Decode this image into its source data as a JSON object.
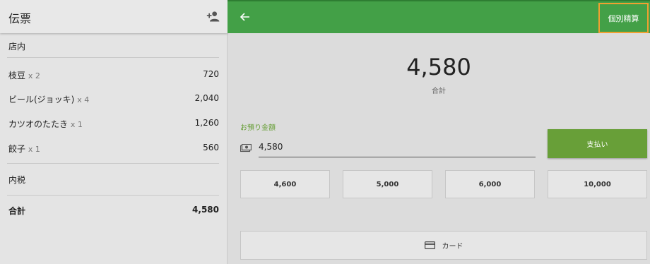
{
  "colors": {
    "topbar": "#43a047",
    "accent_green": "#689f38",
    "highlight_border": "#f0a030"
  },
  "left": {
    "title": "伝票",
    "add_icon": "add-person-icon",
    "store": "店内",
    "items": [
      {
        "name": "枝豆",
        "qty": "x 2",
        "price": "720"
      },
      {
        "name": "ビール(ジョッキ)",
        "qty": "x 4",
        "price": "2,040"
      },
      {
        "name": "カツオのたたき",
        "qty": "x 1",
        "price": "1,260"
      },
      {
        "name": "餃子",
        "qty": "x 1",
        "price": "560"
      }
    ],
    "tax_label": "内税",
    "total_label": "合計",
    "total_value": "4,580"
  },
  "right": {
    "back_icon": "arrow-left-icon",
    "split_button": "個別精算",
    "amount": "4,580",
    "amount_label": "合計",
    "deposit_label": "お預り金額",
    "deposit_icon": "cash-icon",
    "deposit_value": "4,580",
    "pay_button": "支払い",
    "quick_amounts": [
      "4,600",
      "5,000",
      "6,000",
      "10,000"
    ],
    "card_icon": "credit-card-icon",
    "card_button": "カード"
  }
}
